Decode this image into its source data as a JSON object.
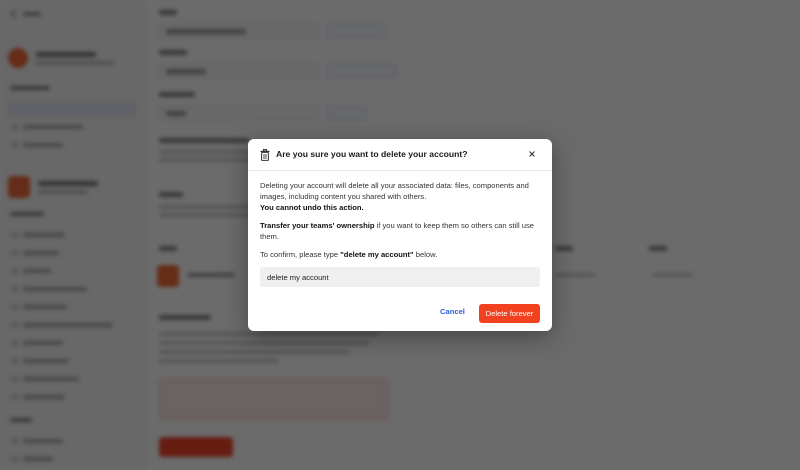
{
  "modal": {
    "title": "Are you sure you want to delete your account?",
    "paragraph1": "Deleting your account will delete all your associated data: files, components and images, including content you shared with others.",
    "paragraph1_bold": "You cannot undo this action.",
    "paragraph2_bold": "Transfer your teams' ownership",
    "paragraph2_rest": " if you want to keep them so others can still use them.",
    "paragraph3_prefix": "To confirm, please type ",
    "paragraph3_phrase": "\"delete my account\"",
    "paragraph3_suffix": " below.",
    "confirm_value": "delete my account",
    "cancel_label": "Cancel",
    "delete_label": "Delete forever",
    "icons": {
      "header": "trash-icon",
      "close": "close-icon"
    }
  },
  "colors": {
    "accent": "#2b5fd9",
    "danger": "#f2411f",
    "overlay": "rgba(0,0,0,0.58)"
  }
}
